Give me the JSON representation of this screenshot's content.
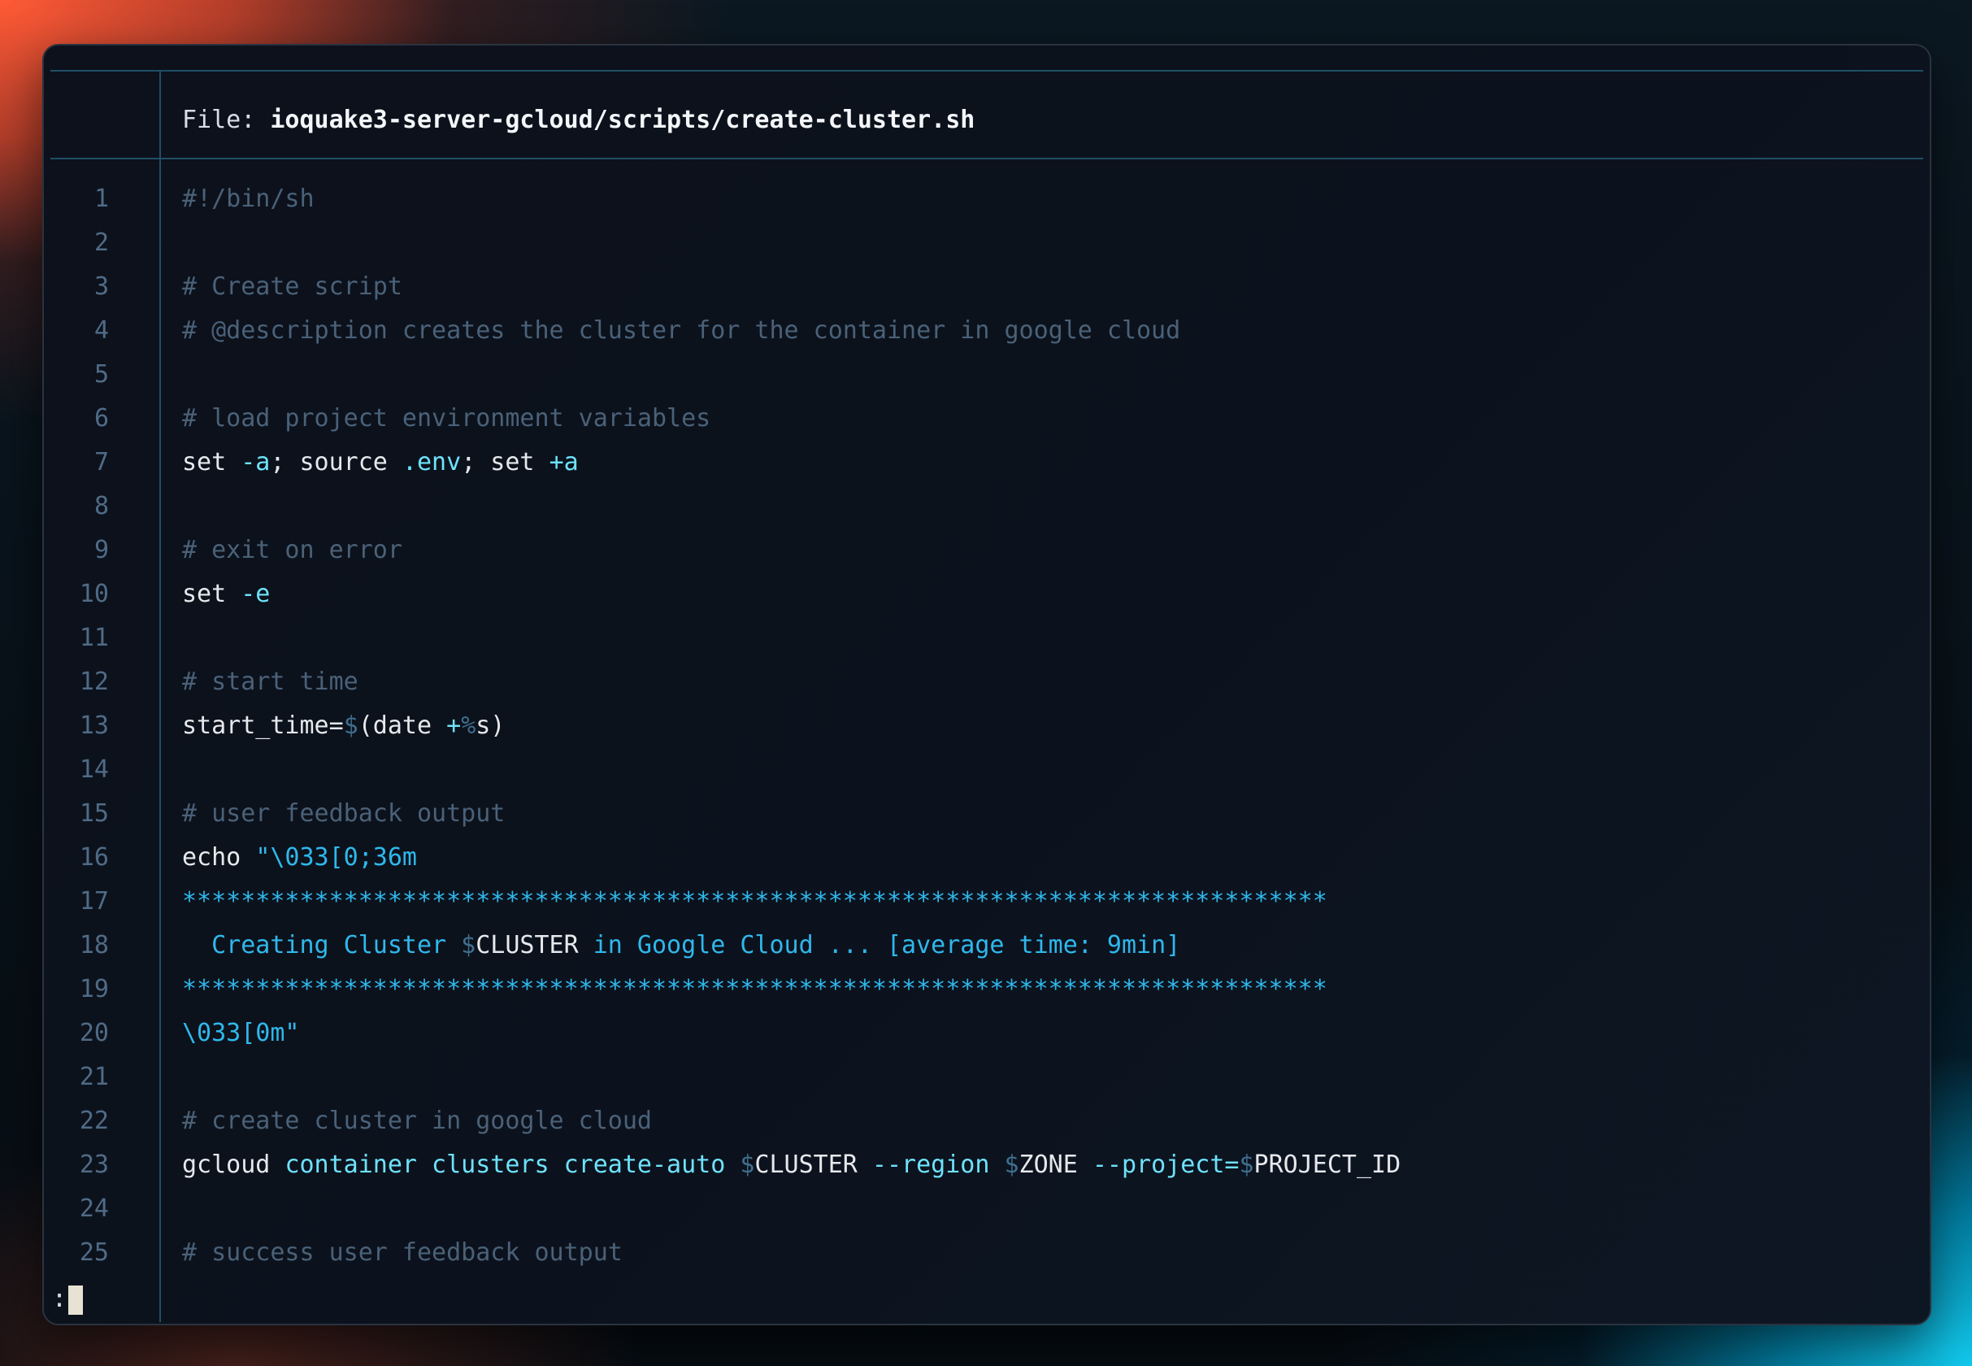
{
  "header": {
    "file_label": "File: ",
    "file_name": "ioquake3-server-gcloud/scripts/create-cluster.sh"
  },
  "lines": [
    {
      "n": "1",
      "tokens": [
        {
          "t": "#!/bin/sh",
          "k": "c"
        }
      ]
    },
    {
      "n": "2",
      "tokens": []
    },
    {
      "n": "3",
      "tokens": [
        {
          "t": "# Create script",
          "k": "c"
        }
      ]
    },
    {
      "n": "4",
      "tokens": [
        {
          "t": "# @description creates the cluster for the container in google cloud",
          "k": "c"
        }
      ]
    },
    {
      "n": "5",
      "tokens": []
    },
    {
      "n": "6",
      "tokens": [
        {
          "t": "# load project environment variables",
          "k": "c"
        }
      ]
    },
    {
      "n": "7",
      "tokens": [
        {
          "t": "set ",
          "k": "df"
        },
        {
          "t": "-a",
          "k": "op"
        },
        {
          "t": "; source ",
          "k": "df"
        },
        {
          "t": ".env",
          "k": "op"
        },
        {
          "t": "; set ",
          "k": "df"
        },
        {
          "t": "+a",
          "k": "op"
        }
      ]
    },
    {
      "n": "8",
      "tokens": []
    },
    {
      "n": "9",
      "tokens": [
        {
          "t": "# exit on error",
          "k": "c"
        }
      ]
    },
    {
      "n": "10",
      "tokens": [
        {
          "t": "set ",
          "k": "df"
        },
        {
          "t": "-e",
          "k": "op"
        }
      ]
    },
    {
      "n": "11",
      "tokens": []
    },
    {
      "n": "12",
      "tokens": [
        {
          "t": "# start time",
          "k": "c"
        }
      ]
    },
    {
      "n": "13",
      "tokens": [
        {
          "t": "start_time=",
          "k": "df"
        },
        {
          "t": "$",
          "k": "ds"
        },
        {
          "t": "(date ",
          "k": "df"
        },
        {
          "t": "+",
          "k": "op"
        },
        {
          "t": "%",
          "k": "ds"
        },
        {
          "t": "s)",
          "k": "df"
        }
      ]
    },
    {
      "n": "14",
      "tokens": []
    },
    {
      "n": "15",
      "tokens": [
        {
          "t": "# user feedback output",
          "k": "c"
        }
      ]
    },
    {
      "n": "16",
      "tokens": [
        {
          "t": "echo ",
          "k": "df"
        },
        {
          "t": "\"\\033[0;36m",
          "k": "st"
        }
      ]
    },
    {
      "n": "17",
      "tokens": [
        {
          "t": "******************************************************************************",
          "k": "st"
        }
      ]
    },
    {
      "n": "18",
      "tokens": [
        {
          "t": "  Creating Cluster ",
          "k": "st"
        },
        {
          "t": "$",
          "k": "ds"
        },
        {
          "t": "CLUSTER",
          "k": "df"
        },
        {
          "t": " in Google Cloud ... [average time: 9min]",
          "k": "st"
        }
      ]
    },
    {
      "n": "19",
      "tokens": [
        {
          "t": "******************************************************************************",
          "k": "st"
        }
      ]
    },
    {
      "n": "20",
      "tokens": [
        {
          "t": "\\033[0m\"",
          "k": "st"
        }
      ]
    },
    {
      "n": "21",
      "tokens": []
    },
    {
      "n": "22",
      "tokens": [
        {
          "t": "# create cluster in google cloud",
          "k": "c"
        }
      ]
    },
    {
      "n": "23",
      "tokens": [
        {
          "t": "gcloud ",
          "k": "df"
        },
        {
          "t": "container clusters create-auto ",
          "k": "op"
        },
        {
          "t": "$",
          "k": "ds"
        },
        {
          "t": "CLUSTER ",
          "k": "df"
        },
        {
          "t": "--region ",
          "k": "op"
        },
        {
          "t": "$",
          "k": "ds"
        },
        {
          "t": "ZONE ",
          "k": "df"
        },
        {
          "t": "--project=",
          "k": "op"
        },
        {
          "t": "$",
          "k": "ds"
        },
        {
          "t": "PROJECT_ID",
          "k": "df"
        }
      ]
    },
    {
      "n": "24",
      "tokens": []
    },
    {
      "n": "25",
      "tokens": [
        {
          "t": "# success user feedback output",
          "k": "c"
        }
      ]
    }
  ],
  "pager": {
    "prompt": ":"
  },
  "colors": {
    "comment": "#4a6178",
    "operator": "#6ee2fb",
    "string": "#2fb8ec",
    "dollar": "#3f6f8f",
    "text": "#e6e8ec",
    "line_number": "#4f6b86",
    "rule": "#1f4f66"
  }
}
